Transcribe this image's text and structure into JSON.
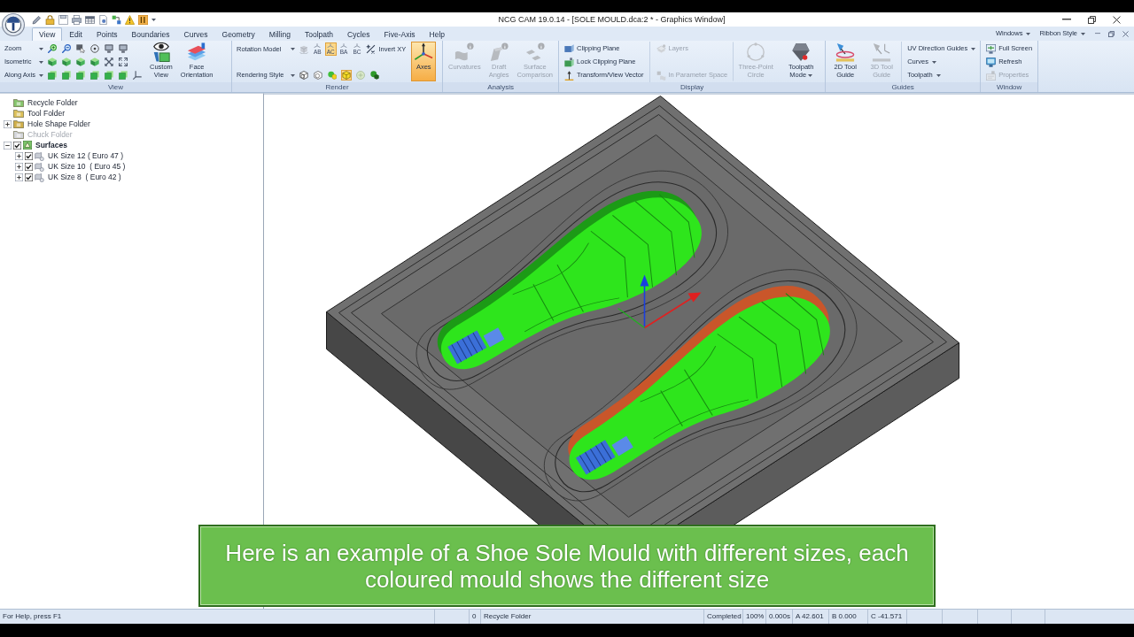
{
  "window": {
    "title": "NCG CAM 19.0.14 - [SOLE MOULD.dca:2 * - Graphics Window]"
  },
  "tabs": [
    {
      "label": "View",
      "selected": true
    },
    {
      "label": "Edit",
      "selected": false
    },
    {
      "label": "Points",
      "selected": false
    },
    {
      "label": "Boundaries",
      "selected": false
    },
    {
      "label": "Curves",
      "selected": false
    },
    {
      "label": "Geometry",
      "selected": false
    },
    {
      "label": "Milling",
      "selected": false
    },
    {
      "label": "Toolpath",
      "selected": false
    },
    {
      "label": "Cycles",
      "selected": false
    },
    {
      "label": "Five-Axis",
      "selected": false
    },
    {
      "label": "Help",
      "selected": false
    }
  ],
  "tab_bar_menus": [
    {
      "label": "Windows"
    },
    {
      "label": "Ribbon Style"
    }
  ],
  "ribbon": [
    {
      "title": "View",
      "parts": [
        {
          "kind": "rows",
          "rows": [
            {
              "label": "Zoom",
              "dropdown": true,
              "items": [
                {
                  "kind": "icon",
                  "active": false
                },
                {
                  "kind": "icon",
                  "active": false
                },
                {
                  "kind": "icon",
                  "active": false
                },
                {
                  "kind": "icon",
                  "active": false
                },
                {
                  "kind": "icon",
                  "active": false
                },
                {
                  "kind": "icon",
                  "active": false
                }
              ]
            },
            {
              "label": "Isometric",
              "dropdown": true,
              "items": [
                {
                  "kind": "icon",
                  "active": false
                },
                {
                  "kind": "icon",
                  "active": false
                },
                {
                  "kind": "icon",
                  "active": false
                },
                {
                  "kind": "icon",
                  "active": false
                },
                {
                  "kind": "icon",
                  "active": false
                },
                {
                  "kind": "icon",
                  "active": false
                }
              ]
            },
            {
              "label": "Along Axis",
              "dropdown": true,
              "items": [
                {
                  "kind": "icon",
                  "active": false
                },
                {
                  "kind": "icon",
                  "active": false
                },
                {
                  "kind": "icon",
                  "active": false
                },
                {
                  "kind": "icon",
                  "active": false
                },
                {
                  "kind": "icon",
                  "active": false
                },
                {
                  "kind": "icon",
                  "active": false
                },
                {
                  "kind": "icon",
                  "active": false
                }
              ]
            }
          ]
        },
        {
          "kind": "large",
          "label": "Custom View",
          "active": false,
          "disabled": false
        },
        {
          "kind": "large",
          "label": "Face Orientation",
          "active": false,
          "disabled": false
        }
      ]
    },
    {
      "title": "Render",
      "parts": [
        {
          "kind": "rows",
          "rows": [
            {
              "label": "Rotation Model",
              "dropdown": true,
              "items": [
                {
                  "kind": "icon",
                  "active": false
                },
                {
                  "kind": "icon",
                  "label": "AB",
                  "active": false
                },
                {
                  "kind": "icon",
                  "label": "AC",
                  "active": true
                },
                {
                  "kind": "icon",
                  "label": "BA",
                  "active": false
                },
                {
                  "kind": "icon",
                  "label": "BC",
                  "active": false
                },
                {
                  "kind": "button",
                  "label": "Invert XY",
                  "active": false
                }
              ]
            },
            {
              "label": "Rendering Style",
              "dropdown": true,
              "items": [
                {
                  "kind": "icon",
                  "active": false
                },
                {
                  "kind": "icon",
                  "active": false
                },
                {
                  "kind": "icon",
                  "active": false
                },
                {
                  "kind": "icon",
                  "active": true
                },
                {
                  "kind": "icon",
                  "active": false
                },
                {
                  "kind": "icon",
                  "active": false
                }
              ]
            }
          ]
        },
        {
          "kind": "large",
          "label": "Axes",
          "active": true,
          "disabled": false
        }
      ]
    },
    {
      "title": "Analysis",
      "parts": [
        {
          "kind": "large",
          "label": "Curvatures",
          "active": false,
          "disabled": true
        },
        {
          "kind": "large",
          "label": "Draft Angles",
          "active": false,
          "disabled": true
        },
        {
          "kind": "large",
          "label": "Surface Comparison",
          "active": false,
          "disabled": true
        }
      ]
    },
    {
      "title": "Display",
      "parts": [
        {
          "kind": "smalls",
          "buttons": [
            {
              "label": "Clipping Plane",
              "disabled": false
            },
            {
              "label": "Lock Clipping Plane",
              "disabled": false
            },
            {
              "label": "Transform/View Vector",
              "disabled": false
            }
          ]
        },
        {
          "kind": "smalls",
          "buttons": [
            {
              "label": "Layers",
              "disabled": true
            },
            {
              "label": "In Parameter Space",
              "disabled": true
            }
          ]
        },
        {
          "kind": "large",
          "label": "Three-Point Circle",
          "active": false,
          "disabled": true
        },
        {
          "kind": "large",
          "label": "Toolpath Mode",
          "active": false,
          "disabled": false,
          "dropdown": true
        }
      ]
    },
    {
      "title": "Guides",
      "parts": [
        {
          "kind": "large",
          "label": "2D Tool Guide",
          "active": false,
          "disabled": false
        },
        {
          "kind": "large",
          "label": "3D Tool Guide",
          "active": false,
          "disabled": true
        },
        {
          "kind": "menus",
          "menus": [
            {
              "label": "UV Direction Guides"
            },
            {
              "label": "Curves"
            },
            {
              "label": "Toolpath"
            }
          ]
        }
      ]
    },
    {
      "title": "Window",
      "parts": [
        {
          "kind": "smalls",
          "buttons": [
            {
              "label": "Full Screen",
              "disabled": false
            },
            {
              "label": "Refresh",
              "disabled": false
            },
            {
              "label": "Properties",
              "disabled": true
            }
          ]
        }
      ]
    }
  ],
  "tree": [
    {
      "kind": "folder",
      "label": "Recycle Folder",
      "disabled": false
    },
    {
      "kind": "folder",
      "label": "Tool Folder",
      "disabled": false
    },
    {
      "kind": "folder",
      "label": "Hole Shape Folder",
      "disabled": false,
      "expanded": false
    },
    {
      "kind": "folder",
      "label": "Chuck Folder",
      "disabled": true
    },
    {
      "kind": "group",
      "label": "Surfaces",
      "disabled": false,
      "checked": true,
      "expanded": true,
      "children": [
        {
          "kind": "layer",
          "label": "UK Size 12 ( Euro 47 )",
          "checked": true,
          "expanded": false
        },
        {
          "kind": "layer",
          "label": "UK Size 10  ( Euro 45 )",
          "checked": true,
          "expanded": false
        },
        {
          "kind": "layer",
          "label": "UK Size 8  ( Euro 42 )",
          "checked": true,
          "expanded": false
        }
      ]
    }
  ],
  "caption": "Here is an example of a Shoe Sole Mould with different sizes, each coloured mould shows the different size",
  "status_bar": {
    "panels": [
      {
        "text": "For Help, press F1"
      },
      {
        "text": "0"
      },
      {
        "text": "Recycle Folder"
      },
      {
        "text": "Completed"
      },
      {
        "text": "100%"
      },
      {
        "text": "0.000s"
      },
      {
        "text": "A 42.601"
      },
      {
        "text": "B 0.000"
      },
      {
        "text": "C -41.571"
      }
    ]
  }
}
